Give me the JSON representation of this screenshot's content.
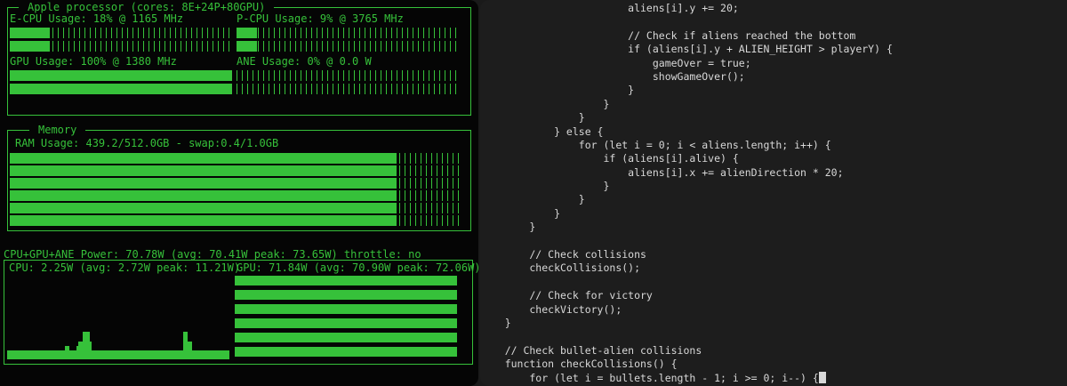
{
  "monitor": {
    "processor_box": {
      "title": "Apple processor (cores: 8E+24P+80GPU)",
      "ecpu_label": "E-CPU Usage: 18% @ 1165 MHz",
      "ecpu_usage": 0.18,
      "pcpu_label": "P-CPU Usage: 9% @ 3765 MHz",
      "pcpu_usage": 0.09,
      "gpu_label": "GPU Usage: 100% @ 1380 MHz",
      "gpu_usage": 1.0,
      "ane_label": "ANE Usage: 0% @ 0.0 W",
      "ane_usage": 0.0
    },
    "memory_box": {
      "title": "Memory",
      "ram_label": "RAM Usage: 439.2/512.0GB - swap:0.4/1.0GB",
      "ram_usage": 0.858
    },
    "power": {
      "total_label": "CPU+GPU+ANE Power: 70.78W (avg: 70.41W peak: 73.65W) throttle: no",
      "cpu_label": "CPU: 2.25W (avg: 2.72W peak: 11.21W)",
      "gpu_label": "GPU: 71.84W (avg: 70.90W peak: 72.06W)",
      "gpu_level": 0.98,
      "cpu_history": [
        0.1,
        0.1,
        0.1,
        0.1,
        0.1,
        0.1,
        0.1,
        0.1,
        0.1,
        0.1,
        0.1,
        0.1,
        0.1,
        0.1,
        0.1,
        0.1,
        0.1,
        0.1,
        0.1,
        0.1,
        0.1,
        0.1,
        0.1,
        0.1,
        0.1,
        0.1,
        0.15,
        0.15,
        0.1,
        0.1,
        0.1,
        0.15,
        0.2,
        0.2,
        0.32,
        0.32,
        0.32,
        0.2,
        0.1,
        0.1,
        0.1,
        0.1,
        0.1,
        0.1,
        0.1,
        0.1,
        0.1,
        0.1,
        0.1,
        0.1,
        0.1,
        0.1,
        0.1,
        0.1,
        0.1,
        0.1,
        0.1,
        0.1,
        0.1,
        0.1,
        0.1,
        0.1,
        0.1,
        0.1,
        0.1,
        0.1,
        0.1,
        0.1,
        0.1,
        0.1,
        0.1,
        0.1,
        0.1,
        0.1,
        0.1,
        0.1,
        0.1,
        0.1,
        0.1,
        0.32,
        0.32,
        0.2,
        0.2,
        0.1,
        0.1,
        0.1,
        0.1,
        0.1,
        0.1,
        0.1,
        0.1,
        0.1,
        0.1,
        0.1,
        0.1,
        0.1,
        0.1,
        0.1,
        0.1,
        0.1
      ]
    }
  },
  "editor": {
    "lines": [
      "                        aliens[i].y += 20;",
      "",
      "                        // Check if aliens reached the bottom",
      "                        if (aliens[i].y + ALIEN_HEIGHT > playerY) {",
      "                            gameOver = true;",
      "                            showGameOver();",
      "                        }",
      "                    }",
      "                }",
      "            } else {",
      "                for (let i = 0; i < aliens.length; i++) {",
      "                    if (aliens[i].alive) {",
      "                        aliens[i].x += alienDirection * 20;",
      "                    }",
      "                }",
      "            }",
      "        }",
      "",
      "        // Check collisions",
      "        checkCollisions();",
      "",
      "        // Check for victory",
      "        checkVictory();",
      "    }",
      "",
      "    // Check bullet-alien collisions",
      "    function checkCollisions() {",
      "        for (let i = bullets.length - 1; i >= 0; i--) {"
    ]
  }
}
